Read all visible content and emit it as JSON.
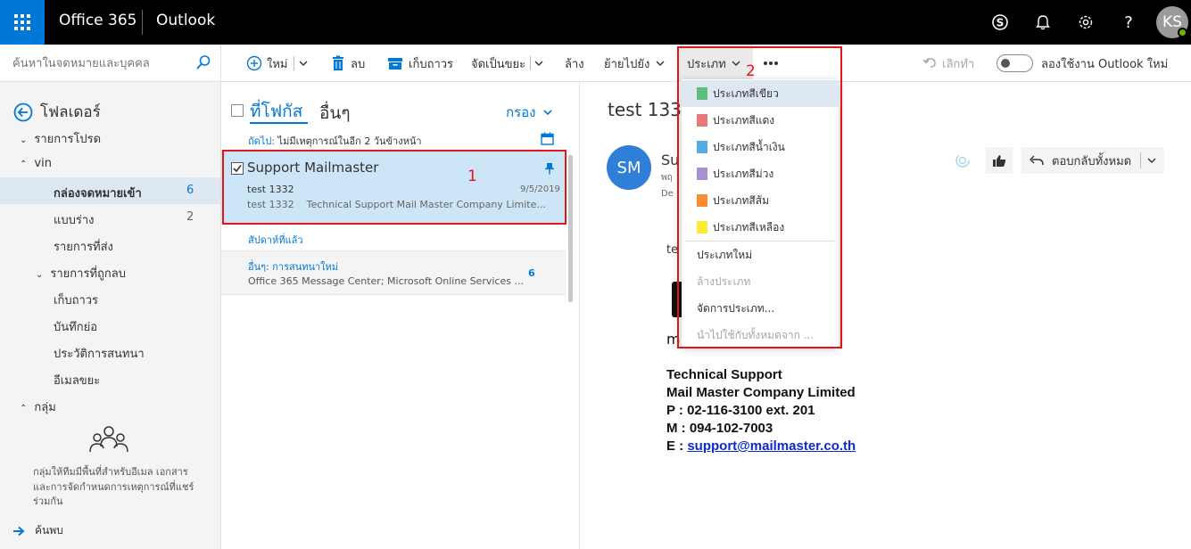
{
  "topbar": {
    "brand": "Office 365",
    "app": "Outlook",
    "avatar_initials": "KS",
    "icons": [
      "waffle-icon",
      "skype-icon",
      "bell-icon",
      "gear-icon",
      "help-icon"
    ]
  },
  "search": {
    "placeholder": "ค้นหาในจดหมายและบุคคล"
  },
  "toolbar": {
    "new": "ใหม่",
    "delete": "ลบ",
    "archive": "เก็บถาวร",
    "junk": "จัดเป็นขยะ",
    "sweep": "ล้าง",
    "move": "ย้ายไปยัง",
    "categorize": "ประเภท",
    "undo": "เลิกทำ",
    "try_new": "ลองใช้งาน Outlook ใหม่"
  },
  "nav": {
    "folders_title": "โฟลเดอร์",
    "favorites": "รายการโปรด",
    "account": "vin",
    "inbox": "กล่องจดหมายเข้า",
    "inbox_count": "6",
    "drafts": "แบบร่าง",
    "drafts_count": "2",
    "sent": "รายการที่ส่ง",
    "deleted": "รายการที่ถูกลบ",
    "archive": "เก็บถาวร",
    "notes": "บันทึกย่อ",
    "conversation_history": "ประวัติการสนทนา",
    "junk": "อีเมลขยะ",
    "groups": "กลุ่ม",
    "groups_desc_1": "กลุ่มให้ทีมมีพื้นที่สำหรับอีเมล เอกสาร",
    "groups_desc_2": "และการจัดกำหนดการเหตุการณ์ที่แชร์",
    "groups_desc_3": "ร่วมกัน",
    "discover": "ค้นพบ"
  },
  "list": {
    "tab_focused": "ที่โฟกัส",
    "tab_other": "อื่นๆ",
    "filter": "กรอง",
    "next_label": "ถัดไป:",
    "next_text": "ไม่มีเหตุการณ์ในอีก 2 วันข้างหน้า",
    "selected": {
      "sender": "Support Mailmaster",
      "subject": "test 1332",
      "date": "9/5/2019",
      "preview": "test 1332    Technical Support Mail Master Company Limite..."
    },
    "last_week": "สัปดาห์ที่แล้ว",
    "other_header": "อื่นๆ: การสนทนาใหม่",
    "other_preview": "Office 365 Message Center; Microsoft Online Services ...",
    "other_count": "6"
  },
  "reading": {
    "subject": "test 1332",
    "sender_initials": "SM",
    "sender_partial": "Su",
    "line2_partial": "พฤ",
    "line3_partial": "De",
    "reply_all": "ตอบกลับทั้งหมด",
    "body_start": "te",
    "body_m": "m",
    "sig1": "Technical Support",
    "sig2": "Mail Master Company Limited",
    "sig3": "P : 02-116-3100 ext. 201",
    "sig4": "M : 094-102-7003",
    "sig5_prefix": "E : ",
    "sig5_link": "support@mailmaster.co.th"
  },
  "category_menu": {
    "items": [
      {
        "label": "ประเภทสีเขียว",
        "color": "#5fbe7d"
      },
      {
        "label": "ประเภทสีแดง",
        "color": "#e7777a"
      },
      {
        "label": "ประเภทสีน้ำเงิน",
        "color": "#55abe5"
      },
      {
        "label": "ประเภทสีม่วง",
        "color": "#a890d3"
      },
      {
        "label": "ประเภทสีส้ม",
        "color": "#fb8c32"
      },
      {
        "label": "ประเภทสีเหลือง",
        "color": "#fcec35"
      }
    ],
    "new_category": "ประเภทใหม่",
    "clear_category": "ล้างประเภท",
    "manage": "จัดการประเภท...",
    "apply_all": "นำไปใช้กับทั้งหมดจาก ..."
  },
  "annotations": {
    "one": "1",
    "two": "2"
  },
  "colors": {
    "accent": "#0078d7",
    "selected_bg": "#cde6f7",
    "highlight": "#e3151a"
  }
}
